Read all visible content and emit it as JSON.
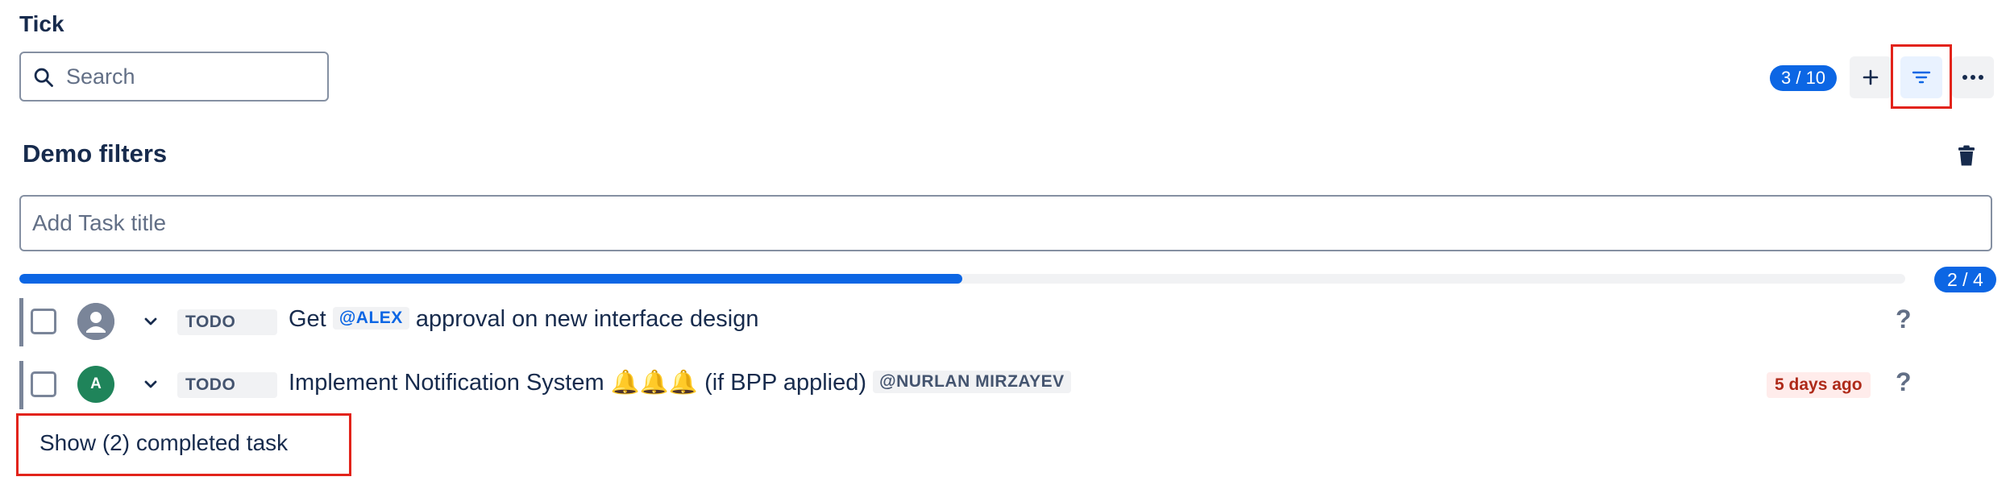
{
  "app": {
    "title": "Tick"
  },
  "search": {
    "placeholder": "Search"
  },
  "toolbar": {
    "count": "3 / 10",
    "add_icon": "plus-icon",
    "filter_icon": "filter-icon",
    "more_icon": "ellipsis-icon"
  },
  "list": {
    "title": "Demo filters",
    "delete_icon": "trash-icon",
    "new_task_placeholder": "Add Task title",
    "progress": {
      "done": 2,
      "total": 4,
      "label": "2 / 4",
      "fraction": 0.5
    }
  },
  "tasks": [
    {
      "avatar": "default-user",
      "status": "TODO",
      "title_before": "Get",
      "mention": "@ALEX",
      "title_after": "approval on new interface design",
      "due": "",
      "help": "?"
    },
    {
      "avatar_letter": "A",
      "status": "TODO",
      "title_before": "Implement Notification System 🔔🔔🔔 (if BPP applied)",
      "mention": "@NURLAN MIRZAYEV",
      "title_after": "",
      "due": "5 days ago",
      "help": "?"
    }
  ],
  "footer": {
    "show_completed": "Show (2) completed task"
  },
  "colors": {
    "accent": "#0c66e4",
    "highlight": "#e2231a",
    "overdue": "#ae2a19"
  }
}
